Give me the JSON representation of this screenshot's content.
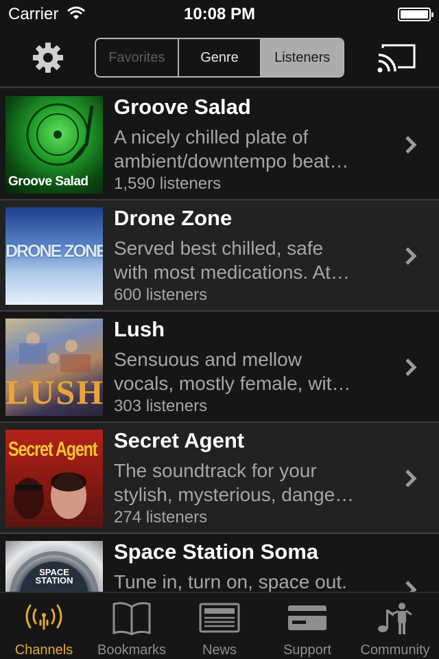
{
  "status_bar": {
    "carrier": "Carrier",
    "time": "10:08 PM"
  },
  "nav": {
    "settings_icon": "gear-icon",
    "cast_icon": "cast-icon",
    "segments": [
      {
        "label": "Favorites",
        "state": "disabled"
      },
      {
        "label": "Genre",
        "state": "normal"
      },
      {
        "label": "Listeners",
        "state": "selected"
      }
    ]
  },
  "channels": [
    {
      "name": "Groove Salad",
      "desc_line1": "A nicely chilled plate of",
      "desc_line2": "ambient/downtempo beat…",
      "listeners": "1,590 listeners",
      "art_text": "Groove Salad"
    },
    {
      "name": "Drone Zone",
      "desc_line1": "Served best chilled, safe",
      "desc_line2": "with most medications. At…",
      "listeners": "600 listeners",
      "art_text": "DRONE ZONE"
    },
    {
      "name": "Lush",
      "desc_line1": "Sensuous and mellow",
      "desc_line2": "vocals, mostly female, wit…",
      "listeners": "303 listeners",
      "art_text": "LUSH"
    },
    {
      "name": "Secret Agent",
      "desc_line1": "The soundtrack for your",
      "desc_line2": "stylish, mysterious, dange…",
      "listeners": "274 listeners",
      "art_text": "Secret Agent"
    },
    {
      "name": "Space Station Soma",
      "desc_line1": "Tune in, turn on, space out.",
      "desc_line2": "",
      "listeners": "",
      "art_text": "SPACE STATION"
    }
  ],
  "tabs": [
    {
      "label": "Channels",
      "icon": "broadcast-icon",
      "selected": true
    },
    {
      "label": "Bookmarks",
      "icon": "book-icon",
      "selected": false
    },
    {
      "label": "News",
      "icon": "newspaper-icon",
      "selected": false
    },
    {
      "label": "Support",
      "icon": "credit-card-icon",
      "selected": false
    },
    {
      "label": "Community",
      "icon": "community-icon",
      "selected": false
    }
  ],
  "colors": {
    "accent": "#e3a935",
    "background": "#1b1b1b",
    "secondary_text": "#a5a5a5"
  }
}
